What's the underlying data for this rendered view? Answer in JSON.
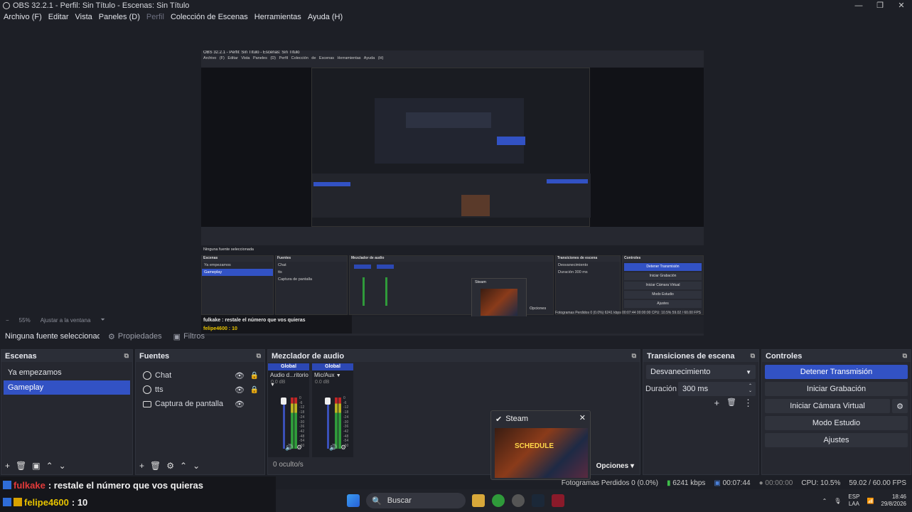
{
  "window": {
    "title": "OBS 32.2.1 - Perfil: Sin Título - Escenas: Sin Título",
    "min": "—",
    "max": "❐",
    "close": "✕"
  },
  "menu": {
    "archivo": "Archivo (F)",
    "editar": "Editar",
    "vista": "Vista",
    "paneles": "Paneles (D)",
    "perfil": "Perfil",
    "coleccion": "Colección de Escenas",
    "herramientas": "Herramientas",
    "ayuda": "Ayuda (H)"
  },
  "zoom": {
    "minus": "−",
    "pct": "55%",
    "fit": "Ajustar a la ventana",
    "arrow": "⏷"
  },
  "source_bar": {
    "none": "Ninguna fuente seleccionada",
    "properties": "Propiedades",
    "filters": "Filtros"
  },
  "scenes": {
    "title": "Escenas",
    "items": [
      "Ya empezamos",
      "Gameplay"
    ],
    "selected": 1
  },
  "sources": {
    "title": "Fuentes",
    "items": [
      "Chat",
      "tts",
      "Captura de pantalla"
    ]
  },
  "mixer": {
    "title": "Mezclador de audio",
    "channels": [
      {
        "badge": "Global",
        "name": "Audio d...ritorio",
        "db": "0.0 dB"
      },
      {
        "badge": "Global",
        "name": "Mic/Aux",
        "db": "0.0 dB"
      }
    ],
    "scale": [
      "0",
      "-6",
      "-12",
      "-18",
      "-24",
      "-30",
      "-36",
      "-42",
      "-48",
      "-54",
      "-60"
    ],
    "hidden": "0 oculto/s"
  },
  "transitions": {
    "title": "Transiciones de escena",
    "type": "Desvanecimiento",
    "duration_label": "Duración",
    "duration": "300 ms"
  },
  "controls": {
    "title": "Controles",
    "stream": "Detener Transmisión",
    "record": "Iniciar Grabación",
    "vcam": "Iniciar Cámara Virtual",
    "studio": "Modo Estudio",
    "settings": "Ajustes"
  },
  "steam_popup": {
    "title": "Steam",
    "thumb_text": "SCHEDULE",
    "options": "Opciones"
  },
  "status": {
    "dropped": "Fotogramas Perdidos 0 (0.0%)",
    "kbps": "6241 kbps",
    "live": "00:07:44",
    "rec": "00:00:00",
    "cpu": "CPU: 10.5%",
    "fps": "59.02 / 60.00 FPS"
  },
  "chat": {
    "line1_user": "fulkake",
    "line1_msg": ": restale el número que vos quieras",
    "line1_color": "#e23a3a",
    "line2_user": "felipe4600",
    "line2_msg": ": 10",
    "line2_color": "#e8c400"
  },
  "taskbar": {
    "search": "Buscar",
    "lang1": "ESP",
    "lang2": "LAA",
    "time": "18:46",
    "date": "29/8/2026"
  },
  "preview_mini": {
    "title": "OBS 32.2.1 - Perfil: Sin Título - Escenas: Sin Título",
    "menu": "Archivo (F) Editar Vista Paneles (D) Perfil Colección de Escenas Herramientas Ayuda (H)",
    "nosrc": "Ninguna fuente seleccionada",
    "scenes": "Escenas",
    "sources": "Fuentes",
    "mixer": "Mezclador de audio",
    "transitions": "Transiciones de escena",
    "controls": "Controles",
    "scene1": "Ya empezamos",
    "scene2": "Gameplay",
    "src1": "Chat",
    "src2": "tts",
    "src3": "Captura de pantalla",
    "trans": "Desvanecimiento",
    "dur": "Duración",
    "durv": "300 ms",
    "c1": "Detener Transmisión",
    "c2": "Iniciar Grabación",
    "c3": "Iniciar Cámara Virtual",
    "c4": "Modo Estudio",
    "c5": "Ajustes",
    "chat1": "fulkake : restale el número que vos quieras",
    "chat2": "felipe4600 : 10",
    "status": "Fotogramas Perdidos 0 (0.0%)  6241 kbps  00:07:44  00:00:00  CPU: 10.5%  59.02 / 60.00 FPS",
    "steam": "Steam",
    "opciones": "Opciones"
  }
}
